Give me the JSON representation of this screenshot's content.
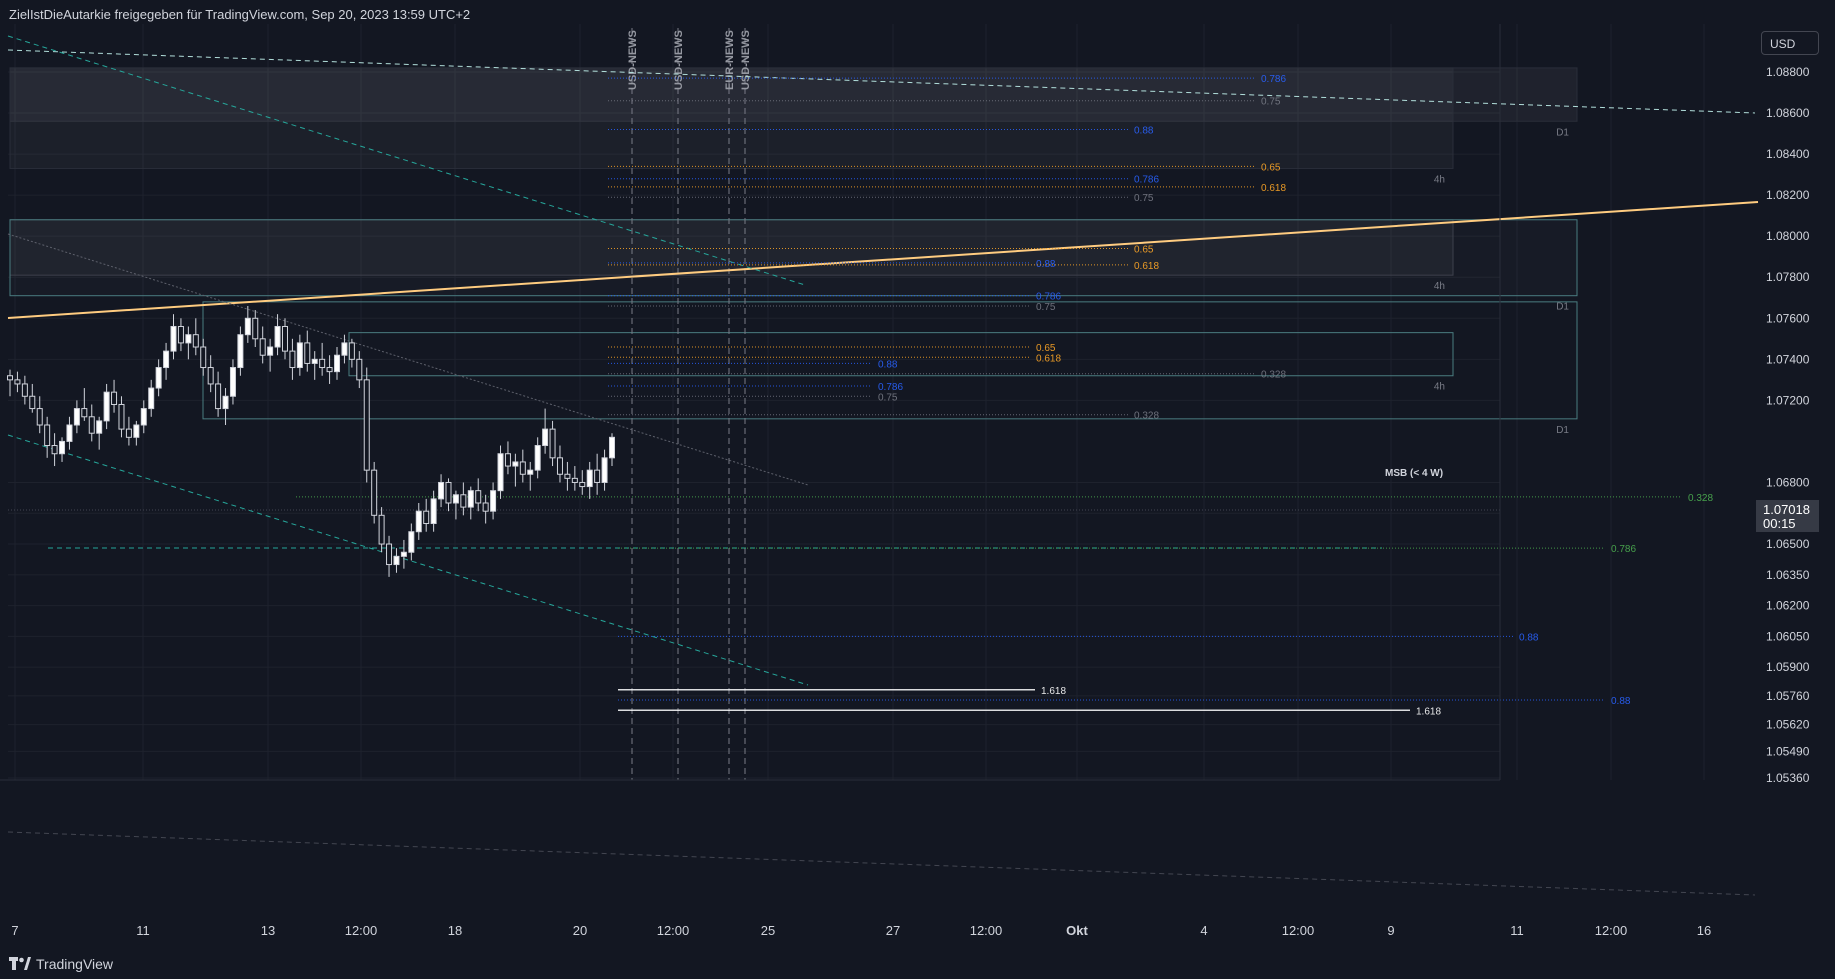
{
  "header": {
    "title": "ZielIstDieAutarkie freigegeben für TradingView.com, Sep 20, 2023 13:59 UTC+2"
  },
  "toolbar": {
    "currency_label": "USD"
  },
  "price_tag": {
    "price": "1.07018",
    "countdown": "00:15"
  },
  "footer": {
    "brand": "TradingView"
  },
  "colors": {
    "background": "#131722",
    "grid": "#1e222d",
    "candle": "#d1d4dc",
    "fib_blue": "#2962ff",
    "fib_orange": "#ffa726",
    "fib_gray": "#787b86",
    "fib_green": "#4caf50",
    "trend_teal": "#26a69a",
    "trend_cream": "#ffcc80",
    "box_border": "#4a7c80"
  },
  "chart_data": {
    "type": "candlestick",
    "symbol_currency": "USD",
    "y_axis": {
      "range": [
        1.0528,
        1.0905
      ],
      "ticks": [
        "1.08800",
        "1.08600",
        "1.08400",
        "1.08200",
        "1.08000",
        "1.07800",
        "1.07600",
        "1.07400",
        "1.07200",
        "1.06800",
        "1.06650",
        "1.06500",
        "1.06350",
        "1.06200",
        "1.06050",
        "1.05900",
        "1.05760",
        "1.05620",
        "1.05490",
        "1.05360"
      ],
      "tick_values": [
        1.088,
        1.086,
        1.084,
        1.082,
        1.08,
        1.078,
        1.076,
        1.074,
        1.072,
        1.068,
        1.0665,
        1.065,
        1.0635,
        1.062,
        1.0605,
        1.059,
        1.0576,
        1.0562,
        1.0549,
        1.0536
      ]
    },
    "x_axis": {
      "ticks": [
        "7",
        "11",
        "13",
        "12:00",
        "18",
        "20",
        "12:00",
        "25",
        "27",
        "12:00",
        "Okt",
        "4",
        "12:00",
        "9",
        "11",
        "12:00",
        "16"
      ],
      "bold_ticks": [
        "Okt"
      ]
    },
    "last_price": 1.07018,
    "candles": [
      [
        1.0732,
        1.0735,
        1.0722,
        1.073
      ],
      [
        1.073,
        1.0734,
        1.0724,
        1.0728
      ],
      [
        1.0728,
        1.0732,
        1.0718,
        1.0722
      ],
      [
        1.0722,
        1.0728,
        1.0714,
        1.0716
      ],
      [
        1.0716,
        1.0722,
        1.0704,
        1.0708
      ],
      [
        1.0708,
        1.0712,
        1.0692,
        1.0698
      ],
      [
        1.0698,
        1.0704,
        1.0688,
        1.0694
      ],
      [
        1.0694,
        1.0702,
        1.069,
        1.07
      ],
      [
        1.07,
        1.0712,
        1.0696,
        1.0708
      ],
      [
        1.0708,
        1.072,
        1.0704,
        1.0716
      ],
      [
        1.0716,
        1.0726,
        1.071,
        1.0712
      ],
      [
        1.0712,
        1.0718,
        1.07,
        1.0704
      ],
      [
        1.0704,
        1.0712,
        1.0696,
        1.071
      ],
      [
        1.071,
        1.0728,
        1.0706,
        1.0724
      ],
      [
        1.0724,
        1.073,
        1.0714,
        1.0718
      ],
      [
        1.0718,
        1.0722,
        1.0702,
        1.0706
      ],
      [
        1.0706,
        1.0712,
        1.0698,
        1.0702
      ],
      [
        1.0702,
        1.071,
        1.0698,
        1.0708
      ],
      [
        1.0708,
        1.072,
        1.0704,
        1.0716
      ],
      [
        1.0716,
        1.073,
        1.0712,
        1.0726
      ],
      [
        1.0726,
        1.074,
        1.0722,
        1.0736
      ],
      [
        1.0736,
        1.0748,
        1.073,
        1.0744
      ],
      [
        1.0744,
        1.0762,
        1.074,
        1.0756
      ],
      [
        1.0756,
        1.076,
        1.0744,
        1.0748
      ],
      [
        1.0748,
        1.0756,
        1.074,
        1.0752
      ],
      [
        1.0752,
        1.076,
        1.0742,
        1.0746
      ],
      [
        1.0746,
        1.075,
        1.0732,
        1.0736
      ],
      [
        1.0736,
        1.0742,
        1.0724,
        1.0728
      ],
      [
        1.0728,
        1.0734,
        1.0712,
        1.0716
      ],
      [
        1.0716,
        1.0726,
        1.0708,
        1.0722
      ],
      [
        1.0722,
        1.074,
        1.0718,
        1.0736
      ],
      [
        1.0736,
        1.0756,
        1.0732,
        1.0752
      ],
      [
        1.0752,
        1.0766,
        1.0748,
        1.076
      ],
      [
        1.076,
        1.0764,
        1.0746,
        1.075
      ],
      [
        1.075,
        1.0756,
        1.0738,
        1.0742
      ],
      [
        1.0742,
        1.075,
        1.0734,
        1.0746
      ],
      [
        1.0746,
        1.0762,
        1.0742,
        1.0756
      ],
      [
        1.0756,
        1.076,
        1.074,
        1.0744
      ],
      [
        1.0744,
        1.075,
        1.073,
        1.0736
      ],
      [
        1.0736,
        1.0752,
        1.0732,
        1.0748
      ],
      [
        1.0748,
        1.0754,
        1.0734,
        1.0738
      ],
      [
        1.0738,
        1.0744,
        1.073,
        1.074
      ],
      [
        1.074,
        1.0748,
        1.0732,
        1.0736
      ],
      [
        1.0736,
        1.0742,
        1.0728,
        1.0734
      ],
      [
        1.0734,
        1.0746,
        1.073,
        1.0742
      ],
      [
        1.0742,
        1.0752,
        1.0738,
        1.0748
      ],
      [
        1.0748,
        1.075,
        1.0736,
        1.074
      ],
      [
        1.074,
        1.0744,
        1.0726,
        1.073
      ],
      [
        1.073,
        1.0736,
        1.068,
        1.0686
      ],
      [
        1.0686,
        1.069,
        1.066,
        1.0664
      ],
      [
        1.0664,
        1.0668,
        1.0646,
        1.065
      ],
      [
        1.065,
        1.0654,
        1.0634,
        1.064
      ],
      [
        1.064,
        1.0648,
        1.0636,
        1.0644
      ],
      [
        1.0644,
        1.0652,
        1.0638,
        1.0646
      ],
      [
        1.0646,
        1.066,
        1.0642,
        1.0656
      ],
      [
        1.0656,
        1.067,
        1.0652,
        1.0666
      ],
      [
        1.0666,
        1.0672,
        1.0656,
        1.066
      ],
      [
        1.066,
        1.0676,
        1.0656,
        1.0672
      ],
      [
        1.0672,
        1.0684,
        1.0668,
        1.068
      ],
      [
        1.068,
        1.0682,
        1.0666,
        1.067
      ],
      [
        1.067,
        1.0676,
        1.0662,
        1.0674
      ],
      [
        1.0674,
        1.068,
        1.0664,
        1.0668
      ],
      [
        1.0668,
        1.0678,
        1.0662,
        1.0676
      ],
      [
        1.0676,
        1.0682,
        1.0666,
        1.067
      ],
      [
        1.067,
        1.0674,
        1.066,
        1.0666
      ],
      [
        1.0666,
        1.068,
        1.0662,
        1.0676
      ],
      [
        1.0676,
        1.0698,
        1.0672,
        1.0694
      ],
      [
        1.0694,
        1.07,
        1.0684,
        1.0688
      ],
      [
        1.0688,
        1.0694,
        1.0678,
        1.069
      ],
      [
        1.069,
        1.0696,
        1.068,
        1.0684
      ],
      [
        1.0684,
        1.069,
        1.0676,
        1.0686
      ],
      [
        1.0686,
        1.0702,
        1.0682,
        1.0698
      ],
      [
        1.0698,
        1.0716,
        1.0694,
        1.0706
      ],
      [
        1.0706,
        1.071,
        1.0688,
        1.0692
      ],
      [
        1.0692,
        1.0698,
        1.068,
        1.0684
      ],
      [
        1.0684,
        1.069,
        1.0676,
        1.0682
      ],
      [
        1.0682,
        1.0688,
        1.0676,
        1.068
      ],
      [
        1.068,
        1.0686,
        1.0674,
        1.0678
      ],
      [
        1.0678,
        1.069,
        1.0672,
        1.0686
      ],
      [
        1.0686,
        1.0694,
        1.0674,
        1.068
      ],
      [
        1.068,
        1.0696,
        1.0676,
        1.0692
      ],
      [
        1.0692,
        1.0704,
        1.0688,
        1.0702
      ]
    ],
    "news_markers": [
      "USD-NEWS",
      "USD-NEWS",
      "EUR-NEWS",
      "USD-NEWS"
    ],
    "zones": [
      {
        "label": "D1",
        "top": 1.0882,
        "bottom": 1.0856
      },
      {
        "label": "4h",
        "top": 1.0882,
        "bottom": 1.0833
      },
      {
        "label": "4h",
        "top": 1.0808,
        "bottom": 1.0781
      },
      {
        "label": "D1",
        "top": 1.0808,
        "bottom": 1.0771
      },
      {
        "label": "D1",
        "top": 1.0768,
        "bottom": 1.0711
      },
      {
        "label": "4h",
        "top": 1.0753,
        "bottom": 1.0732
      }
    ],
    "fib_levels": [
      {
        "label": "0.786",
        "price": 1.0877,
        "color": "blue"
      },
      {
        "label": "0.75",
        "price": 1.0866,
        "color": "gray"
      },
      {
        "label": "0.88",
        "price": 1.0852,
        "color": "blue"
      },
      {
        "label": "0.65",
        "price": 1.0834,
        "color": "orange"
      },
      {
        "label": "0.786",
        "price": 1.0828,
        "color": "blue"
      },
      {
        "label": "0.618",
        "price": 1.0824,
        "color": "orange"
      },
      {
        "label": "0.75",
        "price": 1.0819,
        "color": "gray"
      },
      {
        "label": "0.65",
        "price": 1.0794,
        "color": "orange"
      },
      {
        "label": "0.88",
        "price": 1.0787,
        "color": "blue"
      },
      {
        "label": "0.618",
        "price": 1.0786,
        "color": "orange"
      },
      {
        "label": "0.786",
        "price": 1.0771,
        "color": "blue"
      },
      {
        "label": "0.75",
        "price": 1.0766,
        "color": "gray"
      },
      {
        "label": "0.65",
        "price": 1.0746,
        "color": "orange"
      },
      {
        "label": "0.618",
        "price": 1.0741,
        "color": "orange"
      },
      {
        "label": "0.88",
        "price": 1.0738,
        "color": "blue"
      },
      {
        "label": "0.328",
        "price": 1.0733,
        "color": "gray"
      },
      {
        "label": "0.786",
        "price": 1.0727,
        "color": "blue"
      },
      {
        "label": "0.75",
        "price": 1.0722,
        "color": "gray"
      },
      {
        "label": "0.328",
        "price": 1.0713,
        "color": "gray"
      },
      {
        "label": "0.328",
        "price": 1.0673,
        "color": "green"
      },
      {
        "label": "0.786",
        "price": 1.0648,
        "color": "green"
      },
      {
        "label": "0.88",
        "price": 1.0605,
        "color": "blue"
      },
      {
        "label": "1.618",
        "price": 1.0579,
        "color": "white"
      },
      {
        "label": "0.88",
        "price": 1.0574,
        "color": "blue"
      },
      {
        "label": "1.618",
        "price": 1.0569,
        "color": "white"
      }
    ],
    "annotations": [
      {
        "text": "MSB (< 4 W)",
        "price": 1.0685
      }
    ]
  }
}
